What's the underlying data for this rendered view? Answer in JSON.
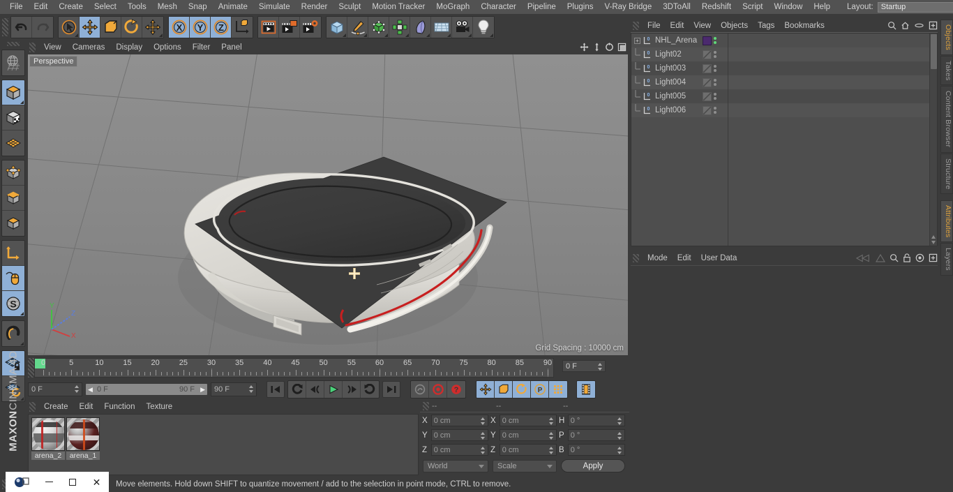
{
  "app": {
    "title": "MAXON CINEMA 4D",
    "brand_line1": "MAXON",
    "brand_line2": "CINEMA 4D"
  },
  "menubar": {
    "items": [
      {
        "label": "File"
      },
      {
        "label": "Edit"
      },
      {
        "label": "Create"
      },
      {
        "label": "Select"
      },
      {
        "label": "Tools"
      },
      {
        "label": "Mesh"
      },
      {
        "label": "Snap"
      },
      {
        "label": "Animate"
      },
      {
        "label": "Simulate"
      },
      {
        "label": "Render"
      },
      {
        "label": "Sculpt"
      },
      {
        "label": "Motion Tracker"
      },
      {
        "label": "MoGraph"
      },
      {
        "label": "Character"
      },
      {
        "label": "Pipeline"
      },
      {
        "label": "Plugins"
      },
      {
        "label": "V-Ray Bridge"
      },
      {
        "label": "3DToAll"
      },
      {
        "label": "Redshift"
      },
      {
        "label": "Script"
      },
      {
        "label": "Window"
      },
      {
        "label": "Help"
      }
    ],
    "layout_label": "Layout:",
    "layout_value": "Startup"
  },
  "toolbar": {
    "groups": [
      {
        "name": "undo-redo",
        "buttons": [
          {
            "name": "undo-button",
            "icon": "undo-icon",
            "active": false
          },
          {
            "name": "redo-button",
            "icon": "redo-icon",
            "active": false
          }
        ]
      },
      {
        "name": "transform-tools",
        "buttons": [
          {
            "name": "live-selection-button",
            "icon": "cursor-select-icon",
            "active": false
          },
          {
            "name": "move-tool-button",
            "icon": "move-arrows-icon",
            "active": true
          },
          {
            "name": "scale-tool-button",
            "icon": "scale-box-icon",
            "active": false
          },
          {
            "name": "rotate-tool-button",
            "icon": "rotate-circle-icon",
            "active": false
          },
          {
            "name": "move-dup-button",
            "icon": "move-arrows-icon",
            "active": false
          }
        ]
      },
      {
        "name": "axis-locks",
        "buttons": [
          {
            "name": "lock-x-button",
            "icon": "axis-x-icon",
            "active": true
          },
          {
            "name": "lock-y-button",
            "icon": "axis-y-icon",
            "active": true
          },
          {
            "name": "lock-z-button",
            "icon": "axis-z-icon",
            "active": true
          },
          {
            "name": "world-object-axis-button",
            "icon": "world-axis-icon",
            "active": false
          }
        ]
      },
      {
        "name": "render-tools",
        "buttons": [
          {
            "name": "render-view-button",
            "icon": "clapper-icon",
            "active": false
          },
          {
            "name": "render-to-picture-viewer-button",
            "icon": "clapper-picture-icon",
            "active": false
          },
          {
            "name": "render-settings-button",
            "icon": "clapper-gear-icon",
            "active": false
          }
        ]
      },
      {
        "name": "create-objects",
        "buttons": [
          {
            "name": "add-cube-button",
            "icon": "cube-icon",
            "active": false
          },
          {
            "name": "add-spline-button",
            "icon": "pen-spline-icon",
            "active": false
          },
          {
            "name": "add-generator-button",
            "icon": "green-cube-icon",
            "active": false
          },
          {
            "name": "add-array-button",
            "icon": "green-cluster-icon",
            "active": false
          },
          {
            "name": "add-deformer-button",
            "icon": "bend-deformer-icon",
            "active": false
          },
          {
            "name": "add-scene-button",
            "icon": "floor-grid-icon",
            "active": false
          },
          {
            "name": "add-camera-button",
            "icon": "camera-icon",
            "active": false
          },
          {
            "name": "add-light-button",
            "icon": "lightbulb-icon",
            "active": false
          }
        ]
      }
    ]
  },
  "left_toolbar": {
    "buttons": [
      {
        "name": "undo-view-button",
        "icon": "globe-grid-icon",
        "active": false
      },
      {
        "name": "model-mode-button",
        "icon": "model-cube-icon",
        "active": true
      },
      {
        "name": "texture-mode-button",
        "icon": "texture-cube-icon",
        "active": false
      },
      {
        "name": "workplane-mode-button",
        "icon": "workplane-icon",
        "active": false
      },
      {
        "name": "points-mode-button",
        "icon": "points-cube-icon",
        "active": false
      },
      {
        "name": "edges-mode-button",
        "icon": "edges-cube-icon",
        "active": false
      },
      {
        "name": "polygons-mode-button",
        "icon": "polygons-cube-icon",
        "active": false
      },
      {
        "name": "axis-modify-button",
        "icon": "axis-arrow-icon",
        "active": false
      },
      {
        "name": "viewport-solo-button",
        "icon": "mouse-icon",
        "active": true
      },
      {
        "name": "enable-snapping-button",
        "icon": "snap-s-icon",
        "active": true
      },
      {
        "name": "magnet-button",
        "icon": "magnet-icon",
        "active": false
      },
      {
        "name": "workplane-lock-button",
        "icon": "workplane-lock-icon",
        "active": true
      },
      {
        "name": "workplane-rotate-button",
        "icon": "workplane-rotate-icon",
        "active": false
      }
    ]
  },
  "viewport": {
    "menu_items": [
      {
        "label": "View"
      },
      {
        "label": "Cameras"
      },
      {
        "label": "Display"
      },
      {
        "label": "Options"
      },
      {
        "label": "Filter"
      },
      {
        "label": "Panel"
      }
    ],
    "camera_label": "Perspective",
    "grid_spacing": "Grid Spacing : 10000 cm",
    "axis_labels": {
      "x": "X",
      "y": "Y",
      "z": "Z"
    },
    "axis_colors": {
      "x": "#d04040",
      "y": "#44c044",
      "z": "#5a7ee0"
    },
    "nav_icons": [
      {
        "name": "pan-view-icon"
      },
      {
        "name": "zoom-view-icon"
      },
      {
        "name": "orbit-view-icon"
      },
      {
        "name": "maximize-view-icon"
      }
    ]
  },
  "timeline": {
    "ticks": [
      0,
      5,
      10,
      15,
      20,
      25,
      30,
      35,
      40,
      45,
      50,
      55,
      60,
      65,
      70,
      75,
      80,
      85,
      90
    ],
    "current_frame_field": "0 F",
    "start_field": "0 F",
    "range_start": "0 F",
    "range_end": "90 F",
    "end_field": "90 F",
    "playback_buttons": [
      {
        "name": "go-to-start-button",
        "icon": "skip-start-icon",
        "active": false
      },
      {
        "name": "previous-key-button",
        "icon": "loop-back-icon",
        "active": false
      },
      {
        "name": "step-back-button",
        "icon": "step-back-icon",
        "active": false
      },
      {
        "name": "play-button",
        "icon": "play-icon",
        "active": false
      },
      {
        "name": "step-forward-button",
        "icon": "step-forward-icon",
        "active": false
      },
      {
        "name": "next-key-button",
        "icon": "loop-forward-icon",
        "active": false
      },
      {
        "name": "go-to-end-button",
        "icon": "skip-end-icon",
        "active": false
      }
    ],
    "record_buttons": [
      {
        "name": "record-active-objects-button",
        "icon": "key-icon",
        "active": false
      },
      {
        "name": "autokeying-button",
        "icon": "record-circle-icon",
        "active": false
      },
      {
        "name": "keyframe-selection-button",
        "icon": "question-circle-icon",
        "active": false
      }
    ],
    "key_toggle_buttons": [
      {
        "name": "position-key-button",
        "icon": "move-arrows-icon",
        "active": true
      },
      {
        "name": "scale-key-button",
        "icon": "scale-box-icon",
        "active": true
      },
      {
        "name": "rotation-key-button",
        "icon": "rotate-circle-icon",
        "active": true
      },
      {
        "name": "parameter-key-button",
        "icon": "param-p-icon",
        "active": true
      },
      {
        "name": "point-level-animation-button",
        "icon": "dots-grid-icon",
        "active": true
      }
    ],
    "last_button": {
      "name": "animation-mode-button",
      "icon": "filmstrip-icon",
      "active": true
    }
  },
  "material_manager": {
    "menu_items": [
      {
        "label": "Create"
      },
      {
        "label": "Edit"
      },
      {
        "label": "Function"
      },
      {
        "label": "Texture"
      }
    ],
    "materials": [
      {
        "name": "arena_2"
      },
      {
        "name": "arena_1"
      }
    ]
  },
  "coordinates": {
    "header_cols": [
      "--",
      "--",
      "--"
    ],
    "rows": [
      {
        "pos_label": "X",
        "pos_value": "0 cm",
        "size_label": "X",
        "size_value": "0 cm",
        "rot_label": "H",
        "rot_value": "0 °"
      },
      {
        "pos_label": "Y",
        "pos_value": "0 cm",
        "size_label": "Y",
        "size_value": "0 cm",
        "rot_label": "P",
        "rot_value": "0 °"
      },
      {
        "pos_label": "Z",
        "pos_value": "0 cm",
        "size_label": "Z",
        "size_value": "0 cm",
        "rot_label": "B",
        "rot_value": "0 °"
      }
    ],
    "system_dropdown": "World",
    "mode_dropdown": "Scale",
    "apply_label": "Apply"
  },
  "object_manager": {
    "menu_items": [
      {
        "label": "File"
      },
      {
        "label": "Edit"
      },
      {
        "label": "View"
      },
      {
        "label": "Objects"
      },
      {
        "label": "Tags"
      },
      {
        "label": "Bookmarks"
      }
    ],
    "icons": [
      {
        "name": "search-icon"
      },
      {
        "name": "home-icon"
      },
      {
        "name": "ellipse-icon"
      },
      {
        "name": "add-layer-icon"
      }
    ],
    "objects": [
      {
        "name": "NHL_Arena",
        "type": "null-object",
        "expandable": true,
        "tag_color": "#4b2a6e",
        "dot_color": "#5fd97a",
        "selected": false
      },
      {
        "name": "Light02",
        "type": "light-object",
        "expandable": false,
        "tag_color": "hatch",
        "dot_color": "#8f8f8f",
        "selected": false
      },
      {
        "name": "Light003",
        "type": "light-object",
        "expandable": false,
        "tag_color": "hatch",
        "dot_color": "#8f8f8f",
        "selected": false
      },
      {
        "name": "Light004",
        "type": "light-object",
        "expandable": false,
        "tag_color": "hatch",
        "dot_color": "#8f8f8f",
        "selected": false
      },
      {
        "name": "Light005",
        "type": "light-object",
        "expandable": false,
        "tag_color": "hatch",
        "dot_color": "#8f8f8f",
        "selected": false
      },
      {
        "name": "Light006",
        "type": "light-object",
        "expandable": false,
        "tag_color": "hatch",
        "dot_color": "#8f8f8f",
        "selected": false
      }
    ]
  },
  "attribute_manager": {
    "menu_items": [
      {
        "label": "Mode"
      },
      {
        "label": "Edit"
      },
      {
        "label": "User Data"
      }
    ],
    "icons": [
      {
        "name": "history-back-icon"
      },
      {
        "name": "history-forward-icon"
      },
      {
        "name": "search-icon"
      },
      {
        "name": "lock-icon"
      },
      {
        "name": "target-icon"
      },
      {
        "name": "add-tab-icon"
      }
    ]
  },
  "side_tabs": {
    "upper": [
      {
        "label": "Objects",
        "selected": true
      },
      {
        "label": "Takes",
        "selected": false
      },
      {
        "label": "Content Browser",
        "selected": false
      },
      {
        "label": "Structure",
        "selected": false
      }
    ],
    "lower": [
      {
        "label": "Attributes",
        "selected": true
      },
      {
        "label": "Layers",
        "selected": false
      }
    ]
  },
  "statusbar": {
    "message": "Move elements. Hold down SHIFT to quantize movement / add to the selection in point mode, CTRL to remove."
  },
  "taskbar": {
    "app_icon": "cinema4d-icon",
    "minimize": "minimize-icon",
    "maximize": "maximize-icon",
    "close": "close-icon"
  },
  "colors": {
    "accent_orange": "#e0a33c",
    "selected_blue": "#8fb0d6",
    "panel_bg": "#3b3b3b",
    "field_bg": "#454545",
    "playhead_green": "#63d98d"
  }
}
